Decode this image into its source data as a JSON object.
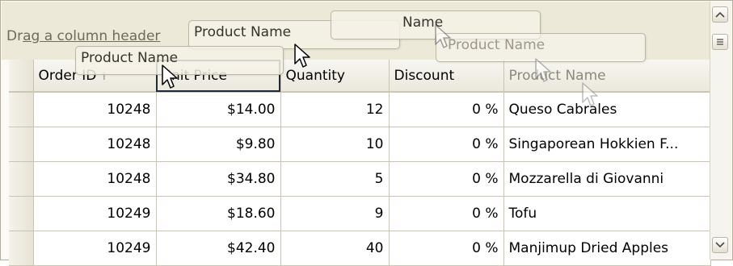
{
  "group_panel": {
    "hint_prefix": "Dr",
    "hint_link": "ag a column header"
  },
  "drag_ghosts": {
    "ghost_a": "Product Name",
    "ghost_b": "Product Name",
    "ghost_c": "Name",
    "ghost_d": "Product Name"
  },
  "columns": [
    {
      "key": "order_id",
      "label": "Order ID",
      "sort": "ascending"
    },
    {
      "key": "unit_price",
      "label": "Unit Price"
    },
    {
      "key": "quantity",
      "label": "Quantity"
    },
    {
      "key": "discount",
      "label": "Discount"
    },
    {
      "key": "product_name",
      "label": "Product Name"
    }
  ],
  "rows": [
    {
      "order_id": "10248",
      "unit_price": "$14.00",
      "quantity": "12",
      "discount": "0 %",
      "product_name": "Queso Cabrales"
    },
    {
      "order_id": "10248",
      "unit_price": "$9.80",
      "quantity": "10",
      "discount": "0 %",
      "product_name": "Singaporean Hokkien F..."
    },
    {
      "order_id": "10248",
      "unit_price": "$34.80",
      "quantity": "5",
      "discount": "0 %",
      "product_name": "Mozzarella di Giovanni"
    },
    {
      "order_id": "10249",
      "unit_price": "$18.60",
      "quantity": "9",
      "discount": "0 %",
      "product_name": "Tofu"
    },
    {
      "order_id": "10249",
      "unit_price": "$42.40",
      "quantity": "40",
      "discount": "0 %",
      "product_name": "Manjimup Dried Apples"
    }
  ],
  "icons": {
    "sort": "sort-ascending-icon",
    "cursor": "mouse-pointer-icon",
    "scroll_up": "chevron-up-icon",
    "scroll_down": "chevron-down-icon",
    "scroll_thumb": "grip-lines-icon"
  },
  "colors": {
    "panel_bg": "#ece9d8",
    "header_border": "#cdc6b0",
    "grid_line": "#c9c3b0"
  }
}
